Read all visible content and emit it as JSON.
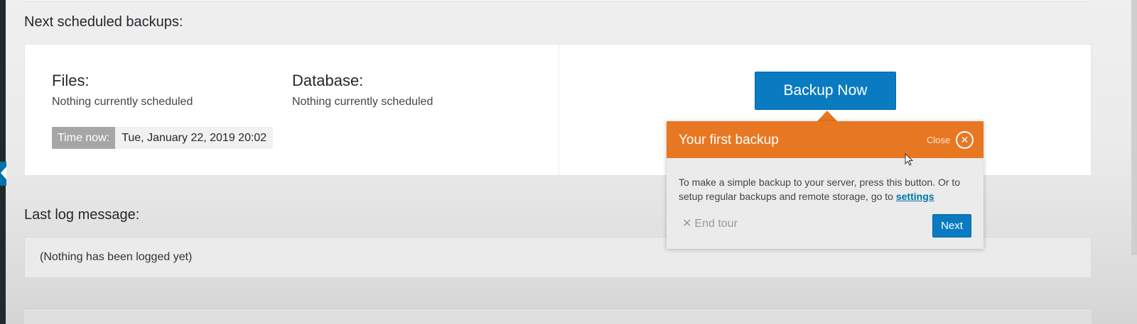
{
  "schedule": {
    "title": "Next scheduled backups:",
    "files_heading": "Files:",
    "files_status": "Nothing currently scheduled",
    "database_heading": "Database:",
    "database_status": "Nothing currently scheduled",
    "time_now_label": "Time now:",
    "time_now_value": "Tue, January 22, 2019 20:02",
    "backup_now_label": "Backup Now"
  },
  "log": {
    "title": "Last log message:",
    "message": "(Nothing has been logged yet)"
  },
  "tour": {
    "title": "Your first backup",
    "close_label": "Close",
    "close_icon": "close-circle-icon",
    "body_text": "To make a simple backup to your server, press this button. Or to setup regular backups and remote storage, go to ",
    "body_link": "settings",
    "end_tour_label": "End tour",
    "next_label": "Next"
  },
  "colors": {
    "accent_blue": "#0a7bc1",
    "tour_orange": "#e87722"
  }
}
